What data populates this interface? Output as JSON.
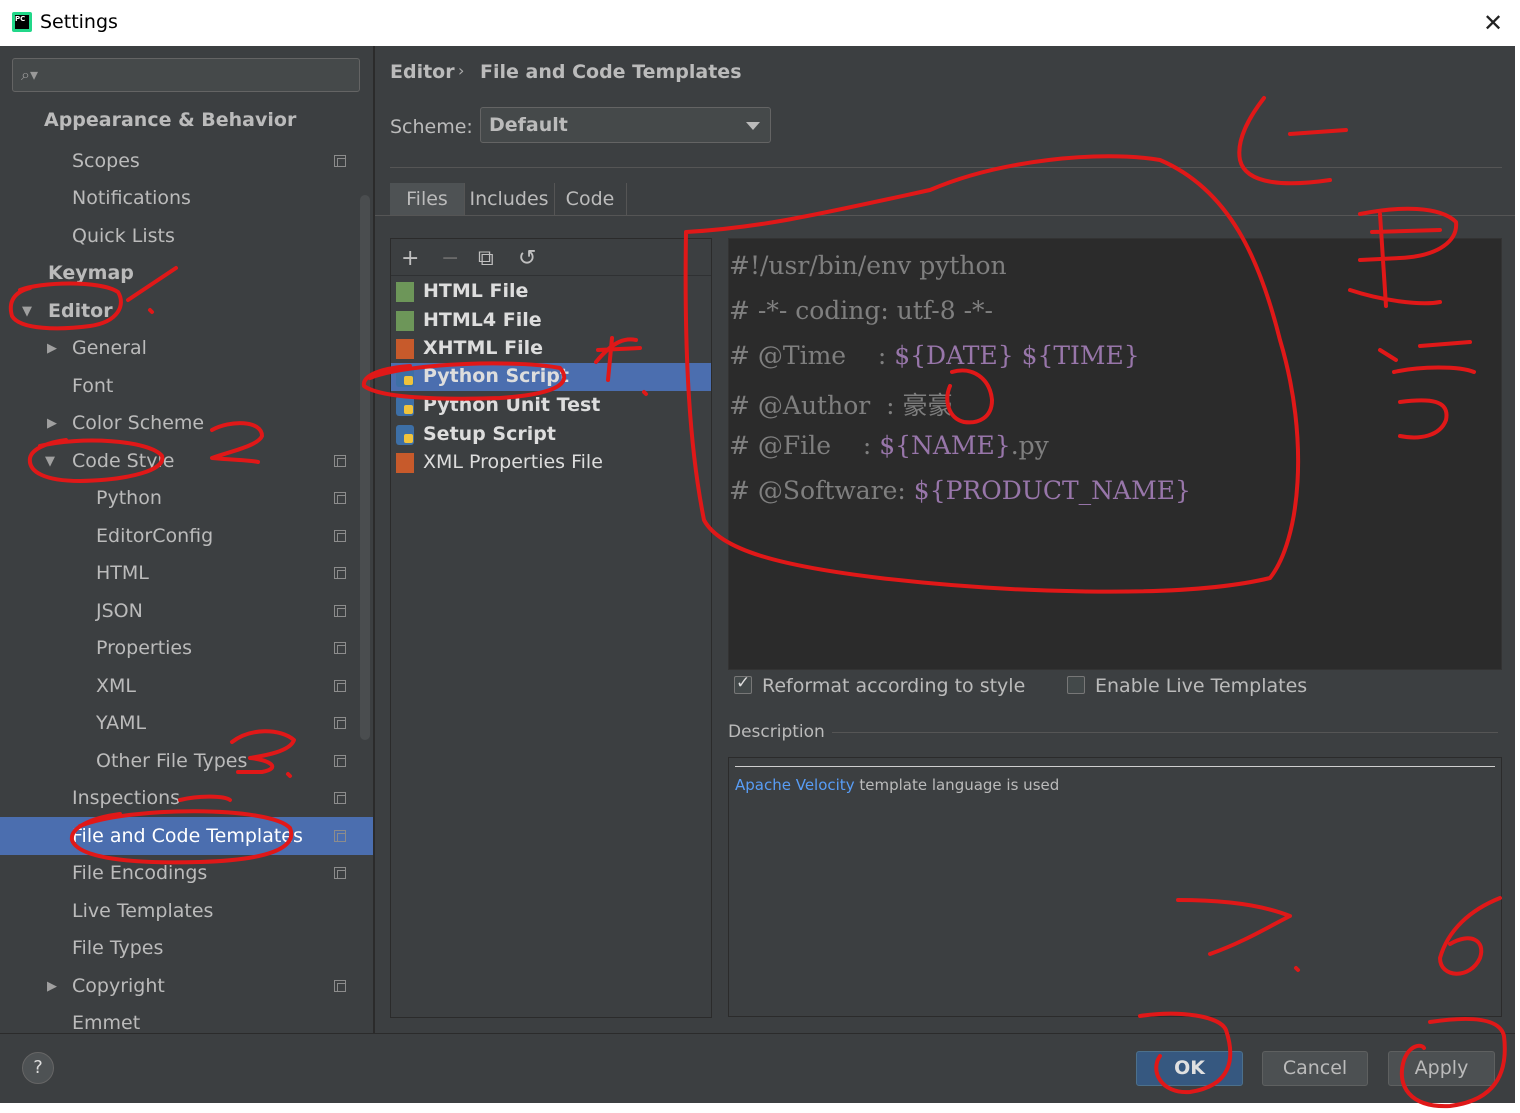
{
  "window": {
    "title": "Settings",
    "app_icon": "PC"
  },
  "sidebar": {
    "search_placeholder": "",
    "items": [
      {
        "label": "Appearance & Behavior",
        "has_copy_icon": false
      },
      {
        "label": "Scopes",
        "has_copy_icon": true
      },
      {
        "label": "Notifications",
        "has_copy_icon": false
      },
      {
        "label": "Quick Lists",
        "has_copy_icon": false
      },
      {
        "label": "Keymap",
        "has_copy_icon": false
      },
      {
        "label": "Editor",
        "expanded": true
      },
      {
        "label": "General",
        "expanded": false
      },
      {
        "label": "Font"
      },
      {
        "label": "Color Scheme",
        "expanded": false
      },
      {
        "label": "Code Style",
        "expanded": true,
        "has_copy_icon": true
      },
      {
        "label": "Python",
        "has_copy_icon": true
      },
      {
        "label": "EditorConfig",
        "has_copy_icon": true
      },
      {
        "label": "HTML",
        "has_copy_icon": true
      },
      {
        "label": "JSON",
        "has_copy_icon": true
      },
      {
        "label": "Properties",
        "has_copy_icon": true
      },
      {
        "label": "XML",
        "has_copy_icon": true
      },
      {
        "label": "YAML",
        "has_copy_icon": true
      },
      {
        "label": "Other File Types",
        "has_copy_icon": true
      },
      {
        "label": "Inspections",
        "has_copy_icon": true
      },
      {
        "label": "File and Code Templates",
        "has_copy_icon": true,
        "selected": true
      },
      {
        "label": "File Encodings",
        "has_copy_icon": true
      },
      {
        "label": "Live Templates"
      },
      {
        "label": "File Types"
      },
      {
        "label": "Copyright",
        "expanded": false,
        "has_copy_icon": true
      },
      {
        "label": "Emmet"
      }
    ]
  },
  "breadcrumb": {
    "parent": "Editor",
    "separator": "›",
    "current": "File and Code Templates"
  },
  "scheme": {
    "label": "Scheme:",
    "value": "Default"
  },
  "tabs": [
    "Files",
    "Includes",
    "Code"
  ],
  "active_tab": "Files",
  "toolbar": {
    "add": "+",
    "remove": "−",
    "copy": "⧉",
    "reset": "↺"
  },
  "templates": [
    {
      "name": "HTML File",
      "icon": "html-file-icon",
      "bold": true
    },
    {
      "name": "HTML4 File",
      "icon": "html-file-icon",
      "bold": true
    },
    {
      "name": "XHTML File",
      "icon": "xhtml-file-icon",
      "bold": true
    },
    {
      "name": "Python Script",
      "icon": "python-file-icon",
      "bold": true,
      "selected": true
    },
    {
      "name": "Python Unit Test",
      "icon": "python-file-icon",
      "bold": true
    },
    {
      "name": "Setup Script",
      "icon": "python-file-icon",
      "bold": true
    },
    {
      "name": "XML Properties File",
      "icon": "xml-file-icon",
      "bold": false
    }
  ],
  "code": {
    "line1": "#!/usr/bin/env python",
    "line2": "# -*- coding: utf-8 -*-",
    "line3_prefix": "# @Time    : ",
    "line3_var1": "${DATE}",
    "line3_space": " ",
    "line3_var2": "${TIME}",
    "line4": "# @Author  : 豪豪",
    "line5_prefix": "# @File    : ",
    "line5_var": "${NAME}",
    "line5_suffix": ".py",
    "line6_prefix": "# @Software: ",
    "line6_var": "${PRODUCT_NAME}"
  },
  "options": {
    "reformat_label": "Reformat according to style",
    "reformat_checked": true,
    "live_templates_label": "Enable Live Templates",
    "live_templates_checked": false
  },
  "description": {
    "title": "Description",
    "link": "Apache Velocity",
    "text": " template language is used"
  },
  "buttons": {
    "help": "?",
    "ok": "OK",
    "cancel": "Cancel",
    "apply": "Apply"
  },
  "annotations": {
    "marks": [
      "1.",
      "2.",
      "3.",
      "4.",
      "5",
      "6",
      "7."
    ],
    "note_glyphs": [
      "更",
      "写"
    ],
    "color": "#e01818"
  },
  "colors": {
    "background": "#3c3f41",
    "selection": "#4b6eaf",
    "editor_bg": "#2b2b2b",
    "variable": "#9876aa",
    "link": "#589df6"
  }
}
